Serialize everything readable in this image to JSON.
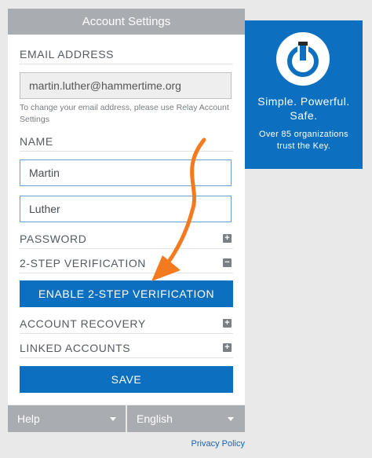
{
  "header": {
    "title": "Account Settings"
  },
  "email": {
    "label": "EMAIL ADDRESS",
    "value": "martin.luther@hammertime.org",
    "help": "To change your email address, please use Relay Account Settings"
  },
  "name": {
    "label": "NAME",
    "first": "Martin",
    "last": "Luther"
  },
  "sections": {
    "password": "PASSWORD",
    "two_step": "2-STEP VERIFICATION",
    "recovery": "ACCOUNT RECOVERY",
    "linked": "LINKED ACCOUNTS"
  },
  "toggles": {
    "expand": "+",
    "collapse": "−"
  },
  "buttons": {
    "enable_2sv": "ENABLE 2-STEP VERIFICATION",
    "save": "SAVE"
  },
  "footer": {
    "help": "Help",
    "language": "English",
    "privacy": "Privacy Policy"
  },
  "promo": {
    "tagline_1": "Simple. Powerful.",
    "tagline_2": "Safe.",
    "sub_1": "Over 85 organizations",
    "sub_2": "trust the Key.",
    "icon": "power-key-icon"
  },
  "colors": {
    "accent": "#0d6fc0",
    "header": "#a9adb2",
    "arrow": "#f47a20"
  }
}
